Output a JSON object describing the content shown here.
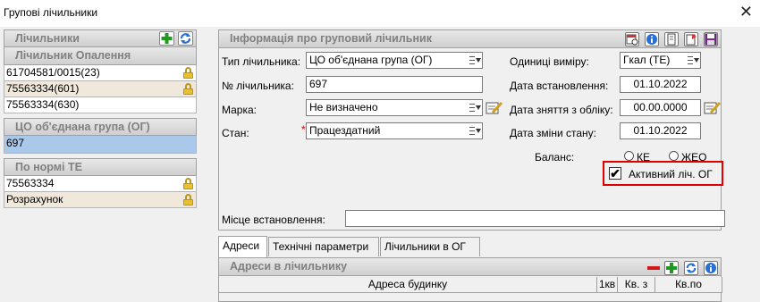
{
  "window": {
    "title": "Групові лічильники",
    "close_glyph": "✕"
  },
  "left": {
    "meters_header": "Лічильники",
    "heating_header": "Лічильник Опалення",
    "heating_items": [
      "61704581/0015(23)",
      "75563334(601)",
      "75563334(630)"
    ],
    "group_header": "ЦО об'єднана група (ОГ)",
    "group_items": [
      "697"
    ],
    "norm_header": "По нормі ТЕ",
    "norm_items": [
      "75563334",
      "Розрахунок"
    ]
  },
  "info": {
    "header": "Інформація про груповий лічильник",
    "type_label": "Тип лічильника:",
    "type_value": "ЦО об'єднана група (ОГ)",
    "number_label": "№ лічильника:",
    "number_value": "697",
    "brand_label": "Марка:",
    "brand_value": "Не визначено",
    "state_label": "Стан:",
    "state_required": "*",
    "state_value": "Працездатний",
    "units_label": "Одиниці виміру:",
    "units_value": "Гкал (ТЕ)",
    "install_date_label": "Дата встановлення:",
    "install_date_value": "01.10.2022",
    "removal_date_label": "Дата зняття з обліку:",
    "removal_date_value": "00.00.0000",
    "state_change_label": "Дата зміни стану:",
    "state_change_value": "01.10.2022",
    "balance_label": "Баланс:",
    "balance_ke": "КЕ",
    "balance_zheo": "ЖЕО",
    "active_label": "Активний ліч. ОГ",
    "active_mark": "✔",
    "location_label": "Місце встановлення:",
    "location_value": ""
  },
  "tabs": [
    "Адреси",
    "Технічні параметри",
    "Лічильники в ОГ"
  ],
  "addresses": {
    "header": "Адреси в лічильнику",
    "columns": [
      "Адреса будинку",
      "1кв",
      "Кв. з",
      "Кв.по"
    ]
  },
  "colors": {
    "selected_row": "#a9c8ea",
    "alt_row": "#efe8db",
    "highlight_border": "#e00000",
    "header_text": "#808080"
  }
}
